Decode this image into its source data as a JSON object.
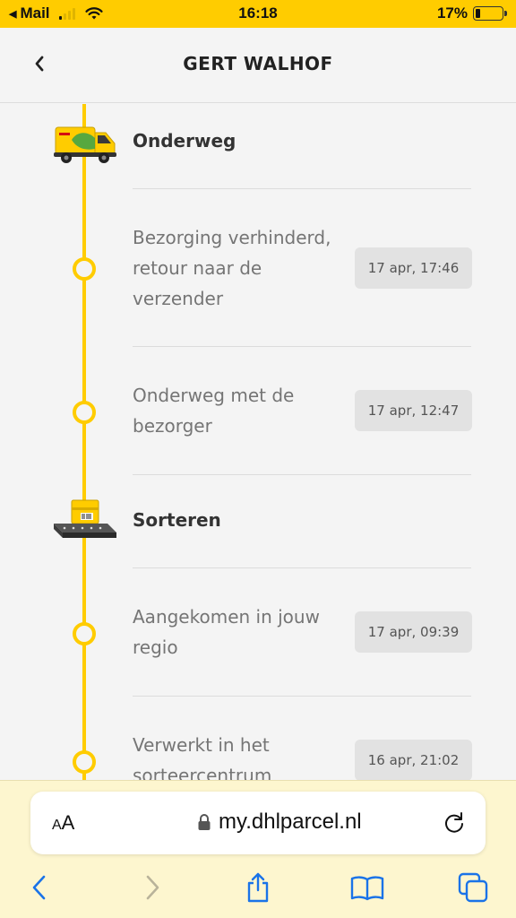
{
  "status_bar": {
    "back_app": "Mail",
    "time": "16:18",
    "battery_percent": "17%",
    "battery_level": 0.17,
    "signal_bars_active": 1
  },
  "header": {
    "title": "GERT WALHOF",
    "back_icon": "chevron-left-icon"
  },
  "timeline": {
    "accent_color": "#ffcc00",
    "sections": [
      {
        "title": "Onderweg",
        "icon": "delivery-van-icon",
        "events": [
          {
            "text": "Bezorging verhinderd, retour naar de verzender",
            "time": "17 apr, 17:46"
          },
          {
            "text": "Onderweg met de bezorger",
            "time": "17 apr, 12:47"
          }
        ]
      },
      {
        "title": "Sorteren",
        "icon": "parcel-conveyor-icon",
        "events": [
          {
            "text": "Aangekomen in jouw regio",
            "time": "17 apr, 09:39"
          },
          {
            "text": "Verwerkt in het sorteercentrum",
            "time": "16 apr, 21:02"
          }
        ]
      }
    ]
  },
  "browser": {
    "text_size_label_small": "A",
    "text_size_label_big": "A",
    "url": "my.dhlparcel.nl",
    "background_color": "#fdf6cf",
    "toolbar_icons": [
      "back-icon",
      "forward-icon",
      "share-icon",
      "bookmarks-icon",
      "tabs-icon"
    ]
  }
}
